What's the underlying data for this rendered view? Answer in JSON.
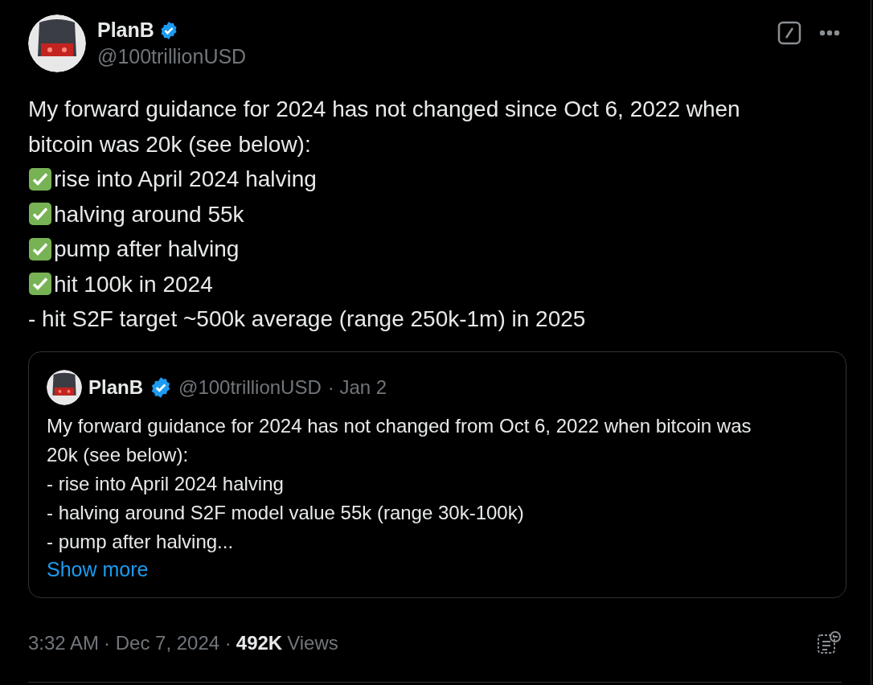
{
  "author": {
    "name": "PlanB",
    "verified": true,
    "handle": "@100trillionUSD"
  },
  "post": {
    "lines": [
      {
        "kind": "plain",
        "text": "My forward guidance for 2024 has not changed since Oct 6, 2022 when bitcoin was 20k (see below):"
      },
      {
        "kind": "check",
        "text": "rise into April 2024 halving"
      },
      {
        "kind": "check",
        "text": "halving around 55k"
      },
      {
        "kind": "check",
        "text": "pump after halving"
      },
      {
        "kind": "check",
        "text": "hit 100k in 2024"
      },
      {
        "kind": "plain",
        "text": "- hit S2F target ~500k average (range 250k-1m) in 2025"
      }
    ]
  },
  "quote": {
    "name": "PlanB",
    "verified": true,
    "handle": "@100trillionUSD",
    "date": "· Jan 2",
    "lines": [
      "My forward guidance for 2024 has not changed from Oct 6, 2022 when bitcoin was 20k (see below):",
      "- rise into April 2024 halving",
      "- halving around S2F model value 55k (range 30k-100k)",
      "- pump after halving..."
    ],
    "show_more": "Show more"
  },
  "meta": {
    "time": "3:32 AM",
    "date": "· Dec 7, 2024 ·",
    "views_count": "492K",
    "views_label": "Views"
  }
}
